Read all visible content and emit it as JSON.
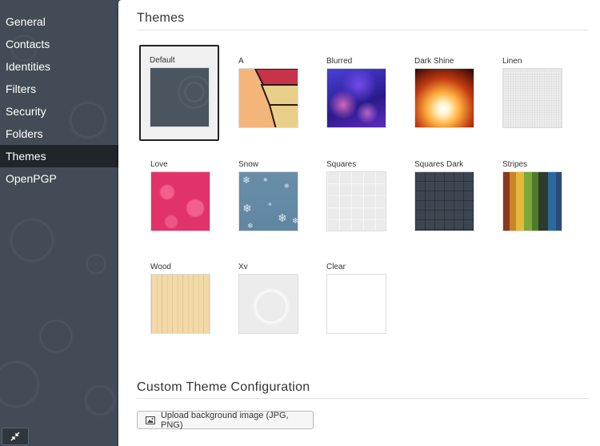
{
  "sidebar": {
    "items": [
      {
        "label": "General"
      },
      {
        "label": "Contacts"
      },
      {
        "label": "Identities"
      },
      {
        "label": "Filters"
      },
      {
        "label": "Security"
      },
      {
        "label": "Folders"
      },
      {
        "label": "Themes",
        "active": true
      },
      {
        "label": "OpenPGP"
      }
    ],
    "collapse_icon": "collapse-arrows-icon"
  },
  "themes_section": {
    "title": "Themes",
    "selected": "Default",
    "themes": [
      {
        "name": "Default"
      },
      {
        "name": "A"
      },
      {
        "name": "Blurred"
      },
      {
        "name": "Dark Shine"
      },
      {
        "name": "Linen"
      },
      {
        "name": "Love"
      },
      {
        "name": "Snow"
      },
      {
        "name": "Squares"
      },
      {
        "name": "Squares Dark"
      },
      {
        "name": "Stripes"
      },
      {
        "name": "Wood"
      },
      {
        "name": "Xv"
      },
      {
        "name": "Clear"
      }
    ]
  },
  "custom_section": {
    "title": "Custom Theme Configuration",
    "upload_label": "Upload background image (JPG, PNG)",
    "upload_icon": "image-icon"
  },
  "colors": {
    "sidebar_bg": "#434c56",
    "active_item_bg": "#1e2328",
    "selected_border": "#222222"
  }
}
